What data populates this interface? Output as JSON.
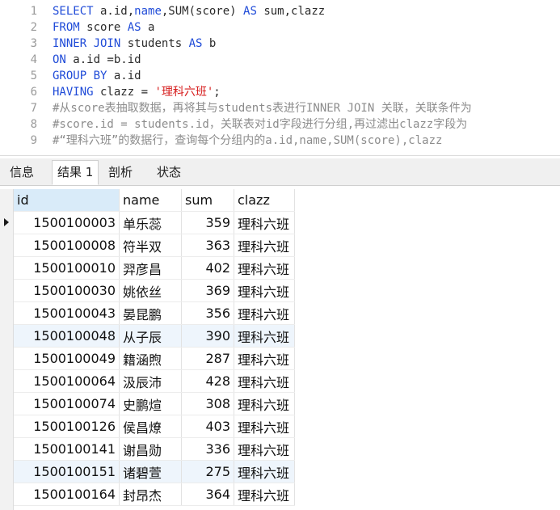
{
  "editor": {
    "line_numbers": [
      "1",
      "2",
      "3",
      "4",
      "5",
      "6",
      "7",
      "8",
      "9"
    ],
    "lines": [
      [
        {
          "t": "SELECT",
          "c": "kw"
        },
        {
          "t": " a.id,",
          "c": ""
        },
        {
          "t": "name",
          "c": "kw"
        },
        {
          "t": ",SUM(score) ",
          "c": ""
        },
        {
          "t": "AS",
          "c": "kw"
        },
        {
          "t": " sum,clazz",
          "c": ""
        }
      ],
      [
        {
          "t": "FROM",
          "c": "kw"
        },
        {
          "t": " score ",
          "c": ""
        },
        {
          "t": "AS",
          "c": "kw"
        },
        {
          "t": " a",
          "c": ""
        }
      ],
      [
        {
          "t": "INNER JOIN",
          "c": "kw"
        },
        {
          "t": " students ",
          "c": ""
        },
        {
          "t": "AS",
          "c": "kw"
        },
        {
          "t": " b",
          "c": ""
        }
      ],
      [
        {
          "t": "ON",
          "c": "kw"
        },
        {
          "t": " a.id =b.id",
          "c": ""
        }
      ],
      [
        {
          "t": "GROUP BY",
          "c": "kw"
        },
        {
          "t": " a.id",
          "c": ""
        }
      ],
      [
        {
          "t": "HAVING",
          "c": "kw"
        },
        {
          "t": " clazz = ",
          "c": ""
        },
        {
          "t": "'理科六班'",
          "c": "str"
        },
        {
          "t": ";",
          "c": ""
        }
      ],
      [
        {
          "t": "#从score表抽取数据，再将其与students表进行INNER JOIN 关联，关联条件为",
          "c": "cmt"
        }
      ],
      [
        {
          "t": "#score.id = students.id，关联表对id字段进行分组,再过滤出clazz字段为",
          "c": "cmt"
        }
      ],
      [
        {
          "t": "#“理科六班”的数据行，查询每个分组内的a.id,name,SUM(score),clazz",
          "c": "cmt"
        }
      ]
    ]
  },
  "tabs": [
    {
      "label": "信息",
      "active": false
    },
    {
      "label": "结果 1",
      "active": true
    },
    {
      "label": "剖析",
      "active": false
    },
    {
      "label": "状态",
      "active": false
    }
  ],
  "results": {
    "columns": [
      "id",
      "name",
      "sum",
      "clazz"
    ],
    "rows": [
      [
        "1500100003",
        "单乐蕊",
        "359",
        "理科六班"
      ],
      [
        "1500100008",
        "符半双",
        "363",
        "理科六班"
      ],
      [
        "1500100010",
        "羿彦昌",
        "402",
        "理科六班"
      ],
      [
        "1500100030",
        "姚依丝",
        "369",
        "理科六班"
      ],
      [
        "1500100043",
        "晏昆鹏",
        "356",
        "理科六班"
      ],
      [
        "1500100048",
        "从子辰",
        "390",
        "理科六班"
      ],
      [
        "1500100049",
        "籍涵煦",
        "287",
        "理科六班"
      ],
      [
        "1500100064",
        "汲辰沛",
        "428",
        "理科六班"
      ],
      [
        "1500100074",
        "史鹏煊",
        "308",
        "理科六班"
      ],
      [
        "1500100126",
        "侯昌燎",
        "403",
        "理科六班"
      ],
      [
        "1500100141",
        "谢昌勋",
        "336",
        "理科六班"
      ],
      [
        "1500100151",
        "诸碧萱",
        "275",
        "理科六班"
      ],
      [
        "1500100164",
        "封昂杰",
        "364",
        "理科六班"
      ]
    ],
    "highlighted_rows": [
      5,
      11
    ]
  },
  "colors": {
    "keyword": "#1f4bd8",
    "string": "#d61c1c",
    "comment": "#8c8c8c",
    "selected_header": "#d9ebf9"
  }
}
